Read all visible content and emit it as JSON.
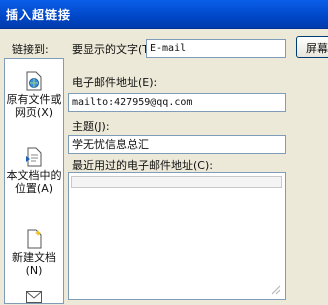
{
  "window": {
    "title": "插入超链接"
  },
  "link_to": {
    "label": "链接到:",
    "items": [
      {
        "label": "原有文件或网页(X)",
        "icon": "globe-file-icon"
      },
      {
        "label": "本文档中的位置(A)",
        "icon": "document-place-icon"
      },
      {
        "label": "新建文档(N)",
        "icon": "new-document-icon"
      },
      {
        "label": "",
        "icon": "email-icon"
      }
    ]
  },
  "display_text": {
    "label": "要显示的文字(T):",
    "value": "E-mail"
  },
  "screen_tip": {
    "label": "屏幕提示"
  },
  "email_address": {
    "label": "电子邮件地址(E):",
    "value": "mailto:427959@qq.com"
  },
  "subject": {
    "label": "主题(J):",
    "value": "学无忧信息总汇"
  },
  "recent_addresses": {
    "label": "最近用过的电子邮件地址(C):"
  }
}
